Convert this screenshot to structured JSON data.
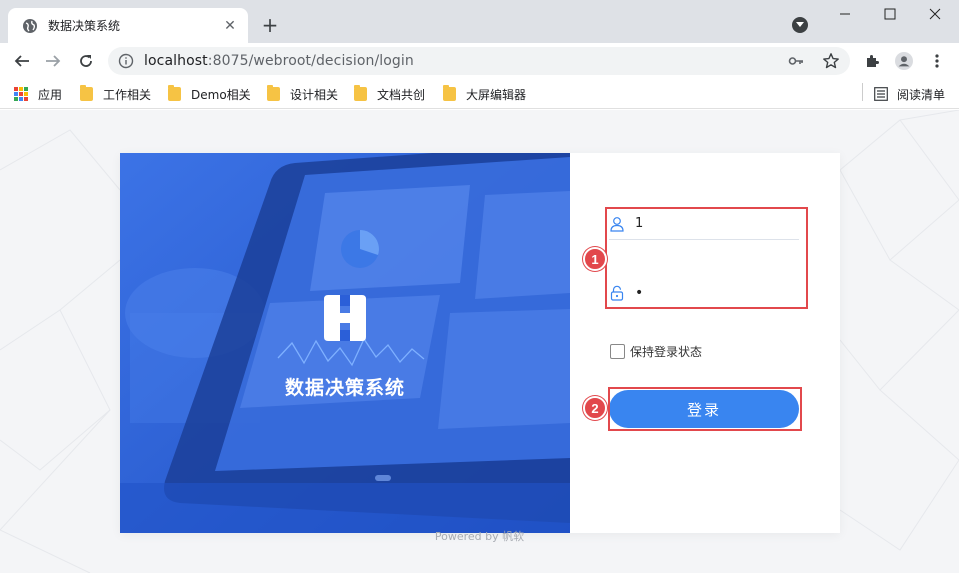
{
  "browser": {
    "tab_title": "数据决策系统",
    "tab_close": "✕",
    "new_tab": "+",
    "url_host": "localhost",
    "url_path": ":8075/webroot/decision/login",
    "bookmarks": [
      {
        "label": "应用",
        "icon": "apps-icon"
      },
      {
        "label": "工作相关",
        "icon": "folder-icon"
      },
      {
        "label": "Demo相关",
        "icon": "folder-icon"
      },
      {
        "label": "设计相关",
        "icon": "folder-icon"
      },
      {
        "label": "文档共创",
        "icon": "folder-icon"
      },
      {
        "label": "大屏编辑器",
        "icon": "folder-icon"
      }
    ],
    "reading_list": "阅读清单"
  },
  "login": {
    "brand_title": "数据决策系统",
    "username_value": "1",
    "password_value": "•",
    "remember_label": "保持登录状态",
    "login_button": "登录",
    "powered_by": "Powered by 帆软"
  },
  "annotations": {
    "one": "1",
    "two": "2"
  },
  "colors": {
    "hero_blue": "#2b5fd8",
    "button_blue": "#3985f0",
    "annotation_red": "#e2484c"
  }
}
